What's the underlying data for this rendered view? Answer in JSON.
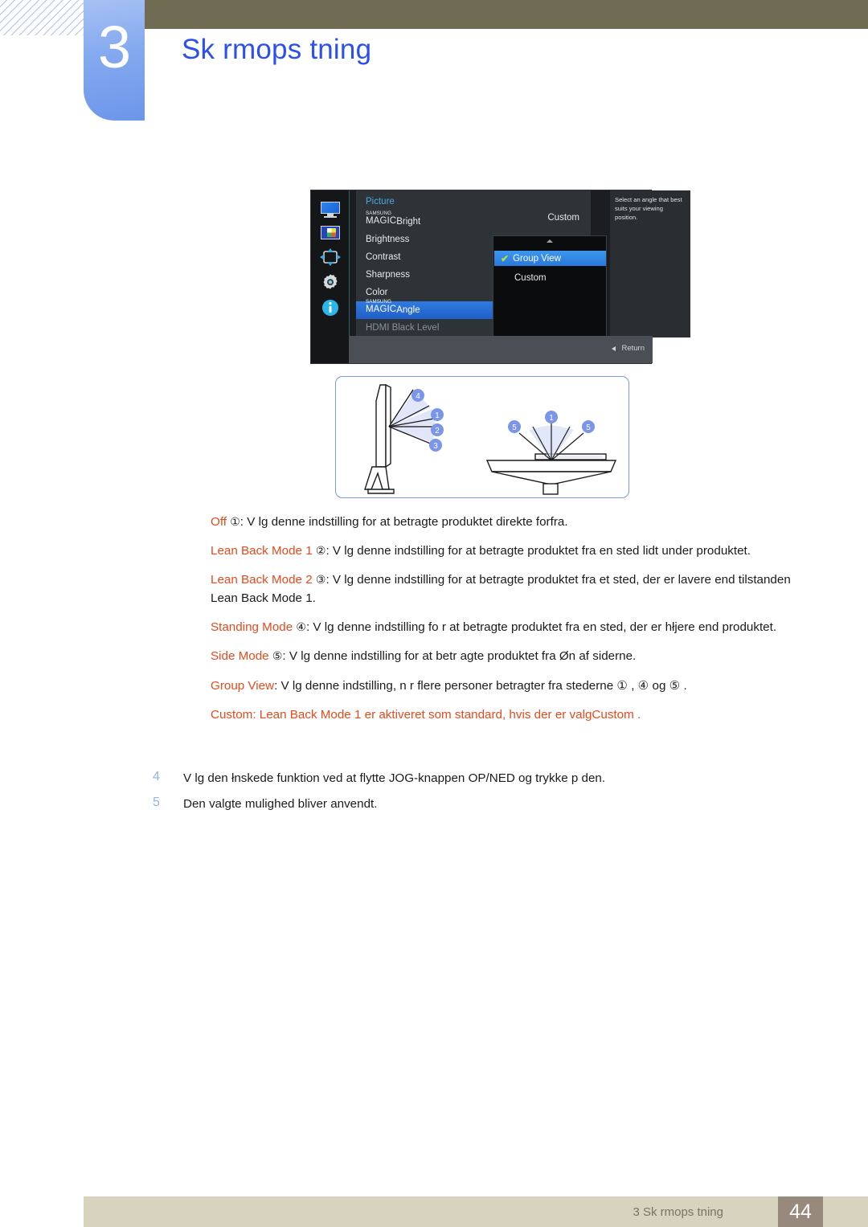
{
  "header": {
    "chapter_number": "3",
    "chapter_title": "Sk rmops tning"
  },
  "osd": {
    "sidebar_icons": [
      "monitor-icon",
      "picture-icon",
      "osd-position-icon",
      "setup-icon",
      "information-icon"
    ],
    "menu_heading": "Picture",
    "rows": [
      {
        "samsung": "SAMSUNG",
        "magic": "MAGIC",
        "suffix": "Bright",
        "value": "Custom"
      },
      {
        "label": "Brightness"
      },
      {
        "label": "Contrast"
      },
      {
        "label": "Sharpness"
      },
      {
        "label": "Color"
      },
      {
        "samsung": "SAMSUNG",
        "magic": "MAGIC",
        "suffix": "Angle",
        "selected": true
      },
      {
        "label": "HDMI Black Level",
        "dim": true
      }
    ],
    "submenu": {
      "options": [
        "Group View",
        "Custom"
      ],
      "checked": "Group View",
      "check_glyph": "✔"
    },
    "tooltip": "Select an angle that best suits your viewing position.",
    "return_label": "Return"
  },
  "figure": {
    "side_view_labels": [
      "4",
      "1",
      "2",
      "3"
    ],
    "top_view_labels": [
      "5",
      "1",
      "5"
    ]
  },
  "body": {
    "paragraphs": [
      {
        "keyword": "Off",
        "circle": "①",
        "text": ": V lg denne indstilling for at betragte produktet direkte forfra."
      },
      {
        "keyword": "Lean Back Mode 1",
        "circle": "②",
        "text": ": V lg denne indstilling for at betragte produktet fra en sted lidt under produktet."
      },
      {
        "keyword": "Lean Back Mode 2",
        "circle": "③",
        "text": ": V lg denne indstilling for at betragte produktet fra et sted, der er lavere end tilstanden Lean Back Mode 1."
      },
      {
        "keyword": "Standing Mode",
        "circle": "④",
        "text": ": V lg denne indstilling fo r at betragte produktet fra en sted, der er hłjere end produktet."
      },
      {
        "keyword": "Side Mode",
        "circle": "⑤",
        "text": ": V lg denne indstilling for at betr agte produktet fra Øn af siderne."
      },
      {
        "keyword": "Group View",
        "circle": "",
        "text": ": V lg denne indstilling, n r flere personer betragter fra stederne ① , ④  og ⑤ ."
      },
      {
        "keyword": "Custom",
        "circle": "",
        "text": ": Lean Back Mode 1  er aktiveret som standard, hvis der er valgCustom ."
      }
    ]
  },
  "steps": [
    {
      "number": "4",
      "text": "V lg den łnskede funktion ved at flytte  JOG-knappen OP/NED og trykke p  den."
    },
    {
      "number": "5",
      "text": "Den valgte mulighed bliver anvendt."
    }
  ],
  "footer": {
    "text": "3 Sk rmops tning",
    "page": "44"
  }
}
